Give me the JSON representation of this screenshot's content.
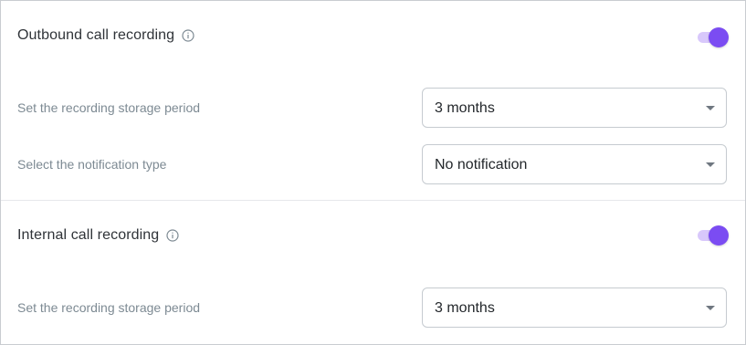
{
  "sections": [
    {
      "title": "Outbound call recording",
      "toggle_on": true,
      "rows": [
        {
          "label": "Set the recording storage period",
          "value": "3 months"
        },
        {
          "label": "Select the notification type",
          "value": "No notification"
        }
      ]
    },
    {
      "title": "Internal call recording",
      "toggle_on": true,
      "rows": [
        {
          "label": "Set the recording storage period",
          "value": "3 months"
        }
      ]
    }
  ],
  "icons": {
    "info": "info-circle-icon",
    "dropdown": "caret-down-icon"
  },
  "colors": {
    "accent": "#7b4cf2",
    "toggle_track": "#d8c8fb",
    "label_text": "#7d8a93",
    "title_text": "#2f3338",
    "border": "#c6cbd0"
  }
}
